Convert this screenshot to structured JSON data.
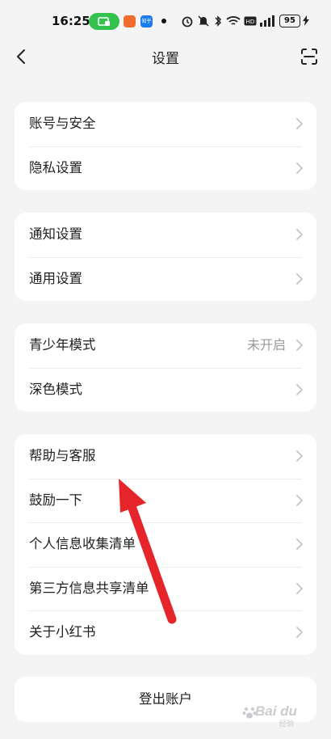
{
  "status_bar": {
    "time": "16:25",
    "app2_label": "知乎",
    "battery": "95"
  },
  "nav": {
    "title": "设置",
    "back_icon": "chevron-left-icon",
    "scan_icon": "scan-icon"
  },
  "groups": [
    {
      "items": [
        {
          "label": "账号与安全"
        },
        {
          "label": "隐私设置"
        }
      ]
    },
    {
      "items": [
        {
          "label": "通知设置"
        },
        {
          "label": "通用设置"
        }
      ]
    },
    {
      "items": [
        {
          "label": "青少年模式",
          "value": "未开启"
        },
        {
          "label": "深色模式"
        }
      ]
    },
    {
      "items": [
        {
          "label": "帮助与客服"
        },
        {
          "label": "鼓励一下"
        },
        {
          "label": "个人信息收集清单"
        },
        {
          "label": "第三方信息共享清单"
        },
        {
          "label": "关于小红书"
        }
      ]
    }
  ],
  "logout_label": "登出账户",
  "watermark": {
    "text": "Bai du",
    "sub": "经验"
  },
  "colors": {
    "background": "#f4f4f5",
    "card": "#ffffff",
    "annotation_arrow": "#e5252a",
    "status_green": "#33c24d"
  }
}
